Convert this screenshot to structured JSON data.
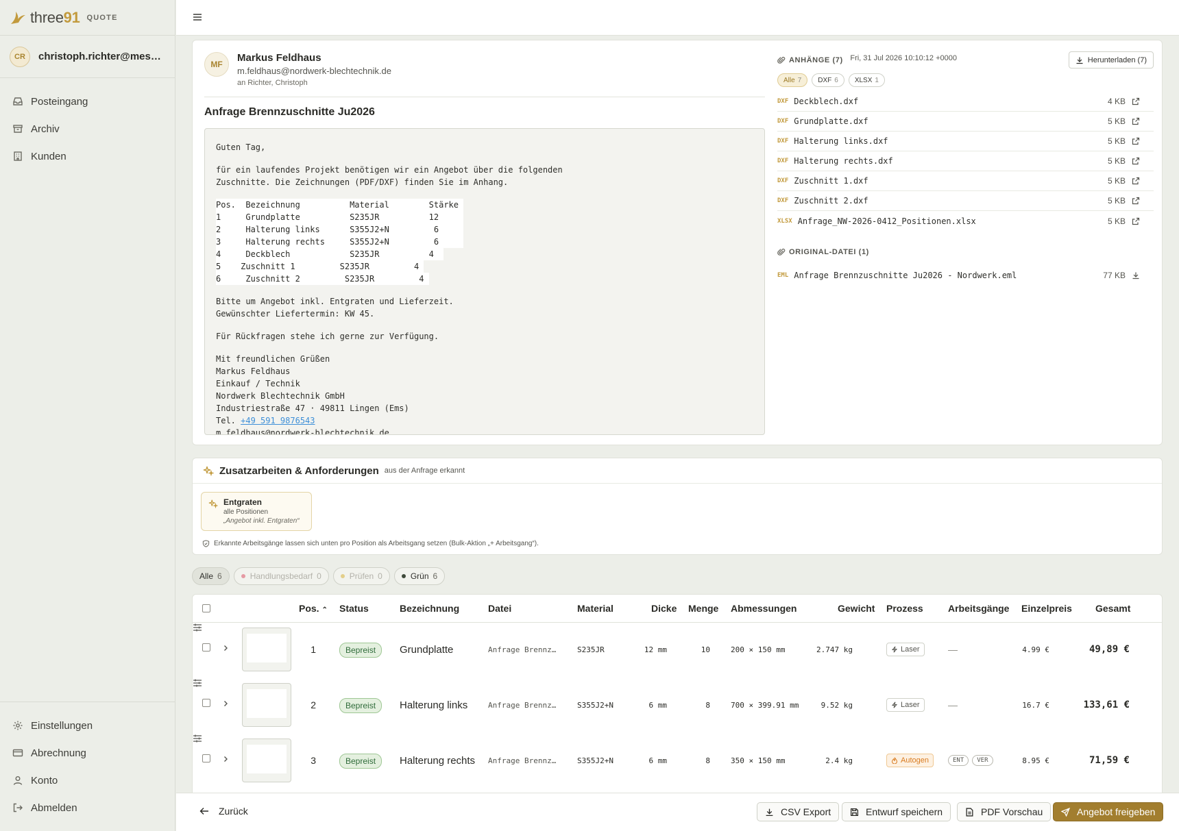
{
  "app": {
    "logo_word_a": "three",
    "logo_word_b": "91",
    "logo_sub": "QUOTE"
  },
  "user": {
    "initials": "CR",
    "email": "christoph.richter@messerwerk.de"
  },
  "nav": {
    "items": [
      {
        "label": "Posteingang",
        "icon": "inbox-icon"
      },
      {
        "label": "Archiv",
        "icon": "archive-icon"
      },
      {
        "label": "Kunden",
        "icon": "building-icon"
      }
    ],
    "bottom": [
      {
        "label": "Einstellungen",
        "icon": "gear-icon"
      },
      {
        "label": "Abrechnung",
        "icon": "credit-card-icon"
      },
      {
        "label": "Konto",
        "icon": "user-icon"
      },
      {
        "label": "Abmelden",
        "icon": "logout-icon"
      }
    ]
  },
  "email": {
    "initials": "MF",
    "sender_name": "Markus Feldhaus",
    "sender_email": "m.feldhaus@nordwerk-blechtechnik.de",
    "to": "an Richter, Christoph",
    "date": "Fri, 31 Jul 2026 10:10:12 +0000",
    "subject": "Anfrage Brennzuschnitte Ju2026",
    "body": {
      "greeting": "Guten Tag,",
      "intro_1": "für ein laufendes Projekt benötigen wir ein Angebot über die folgenden",
      "intro_2": "Zuschnitte. Die Zeichnungen (PDF/DXF) finden Sie im Anhang.",
      "table": [
        "Pos.  Bezeichnung          Material        Stärke ",
        "1     Grundplatte          S235JR          12     ",
        "2     Halterung links      S355J2+N         6     ",
        "3     Halterung rechts     S355J2+N         6     ",
        "4     Deckblech            S235JR          4  ",
        "5    Zuschnitt 1         S235JR         4 ",
        "6     Zuschnitt 2         S235JR         4 "
      ],
      "request_1": "Bitte um Angebot inkl. Entgraten und Lieferzeit.",
      "request_2": "Gewünschter Liefertermin: KW 45.",
      "questions": "Für Rückfragen stehe ich gerne zur Verfügung.",
      "sig_1": "Mit freundlichen Grüßen",
      "sig_2": "Markus Feldhaus",
      "sig_3": "Einkauf / Technik",
      "sig_4": "Nordwerk Blechtechnik GmbH",
      "sig_5": "Industriestraße 47 · 49811 Lingen (Ems)",
      "tel_label": "Tel. ",
      "tel": "+49 591 9876543",
      "sig_7": "m.feldhaus@nordwerk-blechtechnik.de"
    }
  },
  "attachments": {
    "title": "ANHÄNGE (7)",
    "download_label": "Herunterladen (7)",
    "chips": [
      {
        "label": "Alle",
        "count": "7",
        "active": true
      },
      {
        "label": "DXF",
        "count": "6",
        "active": false
      },
      {
        "label": "XLSX",
        "count": "1",
        "active": false
      }
    ],
    "files": [
      {
        "type": "DXF",
        "name": "Deckblech.dxf",
        "size": "4 KB"
      },
      {
        "type": "DXF",
        "name": "Grundplatte.dxf",
        "size": "5 KB"
      },
      {
        "type": "DXF",
        "name": "Halterung links.dxf",
        "size": "5 KB"
      },
      {
        "type": "DXF",
        "name": "Halterung rechts.dxf",
        "size": "5 KB"
      },
      {
        "type": "DXF",
        "name": "Zuschnitt 1.dxf",
        "size": "5 KB"
      },
      {
        "type": "DXF",
        "name": "Zuschnitt 2.dxf",
        "size": "5 KB"
      },
      {
        "type": "XLSX",
        "name": "Anfrage_NW-2026-0412_Positionen.xlsx",
        "size": "5 KB"
      }
    ],
    "original_title": "ORIGINAL-DATEI (1)",
    "original": {
      "type": "EML",
      "name": "Anfrage Brennzuschnitte Ju2026 - Nordwerk.eml",
      "size": "77 KB"
    }
  },
  "requirements": {
    "title": "Zusatzarbeiten & Anforderungen",
    "subtitle": "aus der Anfrage erkannt",
    "item": {
      "title": "Entgraten",
      "scope": "alle Positionen",
      "quote": "„Angebot inkl. Entgraten“"
    },
    "note": "Erkannte Arbeitsgänge lassen sich unten pro Position als Arbeitsgang setzen (Bulk-Aktion „+ Arbeitsgang“)."
  },
  "filters": [
    {
      "label": "Alle",
      "count": "6"
    },
    {
      "label": "Handlungsbedarf",
      "count": "0",
      "color": "#e59aa3"
    },
    {
      "label": "Prüfen",
      "count": "0",
      "color": "#e3cf8a"
    },
    {
      "label": "Grün",
      "count": "6",
      "color": "#3f4a3b"
    }
  ],
  "table": {
    "headers": {
      "pos": "Pos.",
      "status": "Status",
      "bez": "Bezeichnung",
      "datei": "Datei",
      "material": "Material",
      "dicke": "Dicke",
      "menge": "Menge",
      "abm": "Abmessungen",
      "gewicht": "Gewicht",
      "prozess": "Prozess",
      "ag": "Arbeitsgänge",
      "ep": "Einzelpreis",
      "gesamt": "Gesamt"
    },
    "rows": [
      {
        "pos": "1",
        "status": "Bepreist",
        "bez": "Grundplatte",
        "datei": "Anfrage Brennz…",
        "material": "S235JR",
        "dicke": "12 mm",
        "menge": "10",
        "abm": "200 × 150 mm",
        "gewicht": "2.747 kg",
        "prozess": "Laser",
        "ops": [],
        "ops_empty": "—",
        "ep": "4.99 €",
        "gesamt": "49,89 €"
      },
      {
        "pos": "2",
        "status": "Bepreist",
        "bez": "Halterung links",
        "datei": "Anfrage Brennz…",
        "material": "S355J2+N",
        "dicke": "6 mm",
        "menge": "8",
        "abm": "700 × 399.91 mm",
        "gewicht": "9.52 kg",
        "prozess": "Laser",
        "ops": [],
        "ops_empty": "—",
        "ep": "16.7 €",
        "gesamt": "133,61 €"
      },
      {
        "pos": "3",
        "status": "Bepreist",
        "bez": "Halterung rechts",
        "datei": "Anfrage Brennz…",
        "material": "S355J2+N",
        "dicke": "6 mm",
        "menge": "8",
        "abm": "350 × 150 mm",
        "gewicht": "2.4 kg",
        "prozess": "Autogen",
        "ops": [
          "ENT",
          "VER"
        ],
        "ops_empty": "",
        "ep": "8.95 €",
        "gesamt": "71,59 €"
      }
    ]
  },
  "footer": {
    "back": "Zurück",
    "csv": "CSV Export",
    "draft": "Entwurf speichern",
    "pdf": "PDF Vorschau",
    "release": "Angebot freigeben"
  }
}
